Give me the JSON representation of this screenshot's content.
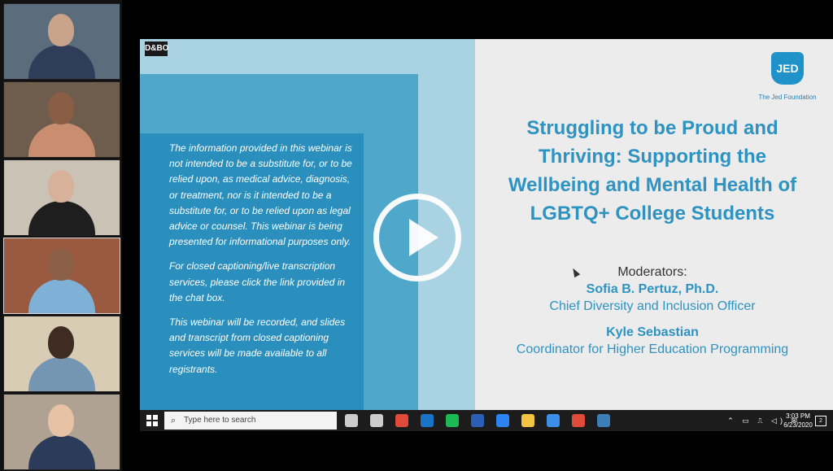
{
  "participants": [
    {
      "bg": "#5b6d7c",
      "skin": "#c9a38a",
      "shirt": "#2f3d5a"
    },
    {
      "bg": "#6e5c4c",
      "skin": "#8a5d45",
      "shirt": "#c98d6f"
    },
    {
      "bg": "#c9c2b5",
      "skin": "#d7b19a",
      "shirt": "#1e1e1e"
    },
    {
      "bg": "#9a5a3f",
      "skin": "#8b5f46",
      "shirt": "#7fb0d6"
    },
    {
      "bg": "#d9ccb5",
      "skin": "#3f2b22",
      "shirt": "#7596b3"
    },
    {
      "bg": "#b0a293",
      "skin": "#e7c2a5",
      "shirt": "#2b3b59"
    }
  ],
  "slide": {
    "brand_mark": "D&BO",
    "disclaimer": [
      "The information provided in this webinar is not intended to be a substitute for, or to be relied upon, as medical advice, diagnosis, or treatment, nor is it intended to be a substitute for, or to be relied upon as legal advice or counsel. This webinar is being presented for informational purposes only.",
      "For closed captioning/live transcription services, please click the link provided in the chat box.",
      "This webinar will be recorded, and slides and transcript from closed captioning services will be made available to all registrants."
    ],
    "logo_text": "JED",
    "logo_caption": "The Jed Foundation",
    "title_lines": [
      "Struggling to be Proud and",
      "Thriving: Supporting the",
      "Wellbeing and Mental Health of",
      "LGBTQ+ College Students"
    ],
    "moderators_label": "Moderators:",
    "moderator1_name": "Sofia B. Pertuz, Ph.D.",
    "moderator1_role": "Chief Diversity and Inclusion Officer",
    "moderator2_name": "Kyle Sebastian",
    "moderator2_role": "Coordinator for Higher Education Programming"
  },
  "taskbar": {
    "search_placeholder": "Type here to search",
    "time": "3:03 PM",
    "date": "6/23/2020",
    "notification_count": "2",
    "apps": [
      {
        "name": "cortana-icon",
        "color": "#cccccc"
      },
      {
        "name": "task-view-icon",
        "color": "#cccccc"
      },
      {
        "name": "chrome-icon",
        "color": "#e04a3a"
      },
      {
        "name": "outlook-icon",
        "color": "#1a73c7"
      },
      {
        "name": "spotify-icon",
        "color": "#1db954"
      },
      {
        "name": "word-icon",
        "color": "#2b5fb4"
      },
      {
        "name": "dropbox-icon",
        "color": "#2b84f0"
      },
      {
        "name": "file-explorer-icon",
        "color": "#f4c542"
      },
      {
        "name": "edge-icon",
        "color": "#3c8ee8"
      },
      {
        "name": "chrome-2-icon",
        "color": "#e04a3a"
      },
      {
        "name": "app-icon",
        "color": "#3b7fb6"
      }
    ],
    "tray_icons": "⌃ ▭ ⎍ ◁) ✉"
  },
  "overlay": {
    "play_label": "Play"
  }
}
